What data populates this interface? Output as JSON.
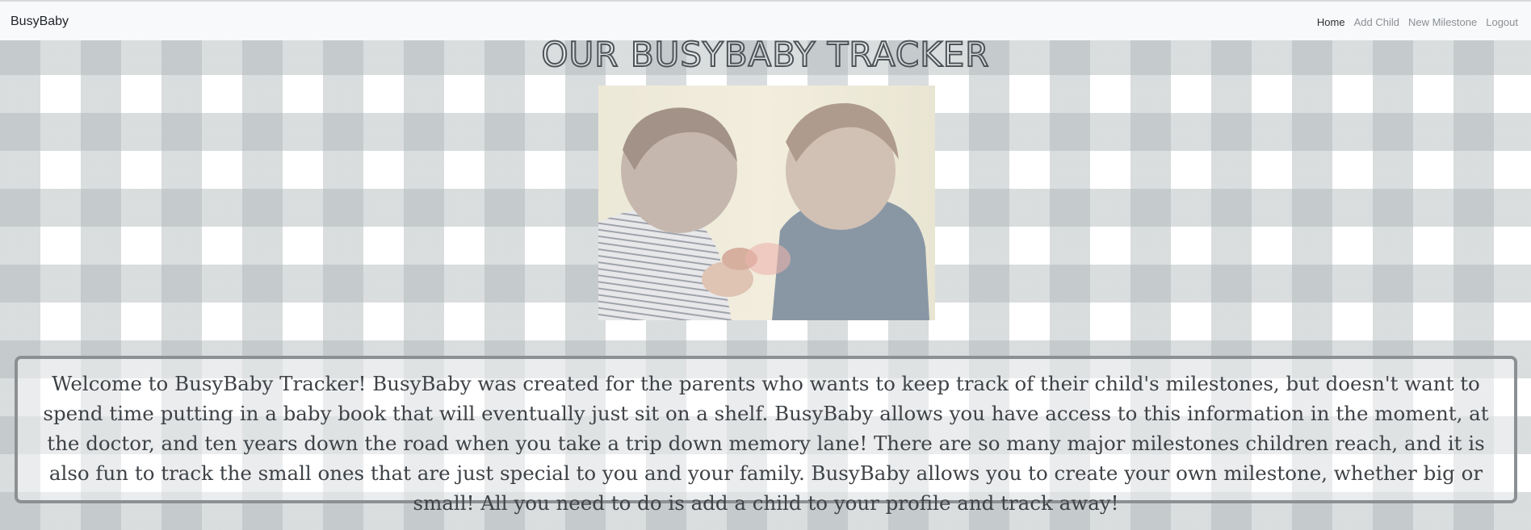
{
  "navbar": {
    "brand": "BusyBaby",
    "links": [
      {
        "label": "Home",
        "active": true
      },
      {
        "label": "Add Child",
        "active": false
      },
      {
        "label": "New Milestone",
        "active": false
      },
      {
        "label": "Logout",
        "active": false
      }
    ]
  },
  "main": {
    "title": "OUR BUSYBABY TRACKER",
    "welcome_text": "Welcome to BusyBaby Tracker! BusyBaby was created for the parents who wants to keep track of their child's milestones, but doesn't want to spend time putting in a baby book that will eventually just sit on a shelf. BusyBaby allows you have access to this information in the moment, at the doctor, and ten years down the road when you take a trip down memory lane! There are so many major milestones children reach, and it is also fun to track the small ones that are just special to you and your family. BusyBaby allows you to create your own milestone, whether big or small! All you need to do is add a child to your profile and track away!"
  },
  "colors": {
    "navbar_bg": "#f8f9fa",
    "gingham": "#a0aaac",
    "box_border": "#8d9093",
    "text": "#3e4246"
  }
}
